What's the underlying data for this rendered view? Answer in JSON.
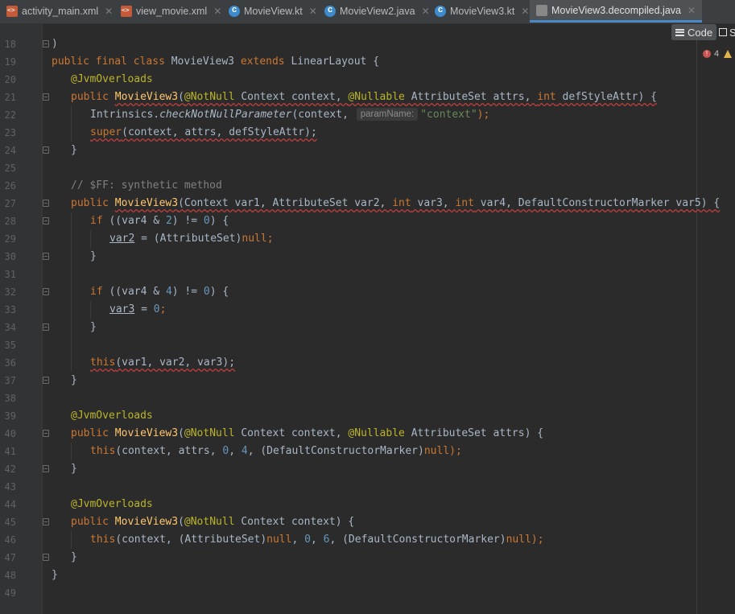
{
  "tabs": [
    {
      "label": "activity_main.xml",
      "icon": "xml-file-icon"
    },
    {
      "label": "view_movie.xml",
      "icon": "xml-file-icon"
    },
    {
      "label": "MovieView.kt",
      "icon": "kotlin-class-icon"
    },
    {
      "label": "MovieView2.java",
      "icon": "java-class-icon"
    },
    {
      "label": "MovieView3.kt",
      "icon": "kotlin-class-icon"
    },
    {
      "label": "MovieView3.decompiled.java",
      "icon": "decompiled-file-icon",
      "active": true
    }
  ],
  "toolbar": {
    "code_label": "Code",
    "split_label": "S"
  },
  "inspection": {
    "error_count": "4"
  },
  "line_numbers": [
    "18",
    "19",
    "20",
    "21",
    "22",
    "23",
    "24",
    "25",
    "26",
    "27",
    "28",
    "29",
    "30",
    "31",
    "32",
    "33",
    "34",
    "35",
    "36",
    "37",
    "38",
    "39",
    "40",
    "41",
    "42",
    "43",
    "44",
    "45",
    "46",
    "47",
    "48",
    "49"
  ],
  "code": {
    "l18": ")",
    "l19_public": "public",
    "l19_final": "final",
    "l19_class": "class",
    "l19_name": "MovieView3",
    "l19_extends": "extends",
    "l19_super": "LinearLayout {",
    "l20": "@JvmOverloads",
    "l21_public": "public",
    "l21_fn": "MovieView3",
    "l21_open": "(",
    "l21_ann1": "@NotNull",
    "l21_p1": " Context context, ",
    "l21_ann2": "@Nullable",
    "l21_p2": " AttributeSet attrs, ",
    "l21_int": "int",
    "l21_p3": " defStyleAttr) {",
    "l22_cls": "Intrinsics.",
    "l22_m": "checkNotNullParameter",
    "l22_a": "(context, ",
    "l22_hint": "paramName:",
    "l22_s": "\"context\"",
    "l22_end": ");",
    "l23_super": "super",
    "l23_rest": "(context, attrs, defStyleAttr);",
    "l24": "}",
    "l26": "// $FF: synthetic method",
    "l27_public": "public",
    "l27_fn": "MovieView3",
    "l27_a": "(Context var1, AttributeSet var2, ",
    "l27_int1": "int",
    "l27_b": " var3, ",
    "l27_int2": "int",
    "l27_c": " var4, DefaultConstructorMarker var5) {",
    "l28_if": "if",
    "l28_a": " ((var4 & ",
    "l28_n": "2",
    "l28_b": ") != ",
    "l28_z": "0",
    "l28_c": ") {",
    "l29_v": "var2",
    "l29_a": " = (AttributeSet)",
    "l29_null": "null",
    "l29_semi": ";",
    "l30": "}",
    "l32_if": "if",
    "l32_a": " ((var4 & ",
    "l32_n": "4",
    "l32_b": ") != ",
    "l32_z": "0",
    "l32_c": ") {",
    "l33_v": "var3",
    "l33_a": " = ",
    "l33_z": "0",
    "l33_semi": ";",
    "l34": "}",
    "l36_this": "this",
    "l36_rest": "(var1, var2, var3);",
    "l37": "}",
    "l39": "@JvmOverloads",
    "l40_public": "public",
    "l40_fn": "MovieView3",
    "l40_open": "(",
    "l40_ann1": "@NotNull",
    "l40_p1": " Context context, ",
    "l40_ann2": "@Nullable",
    "l40_p2": " AttributeSet attrs) {",
    "l41_this": "this",
    "l41_a": "(context, attrs, ",
    "l41_z": "0",
    "l41_b": ", ",
    "l41_n": "4",
    "l41_c": ", (DefaultConstructorMarker)",
    "l41_null": "null",
    "l41_end": ");",
    "l42": "}",
    "l44": "@JvmOverloads",
    "l45_public": "public",
    "l45_fn": "MovieView3",
    "l45_open": "(",
    "l45_ann": "@NotNull",
    "l45_p": " Context context) {",
    "l46_this": "this",
    "l46_a": "(context, (AttributeSet)",
    "l46_null1": "null",
    "l46_b": ", ",
    "l46_z": "0",
    "l46_c": ", ",
    "l46_n": "6",
    "l46_d": ", (DefaultConstructorMarker)",
    "l46_null2": "null",
    "l46_end": ");",
    "l47": "}",
    "l48": "}"
  }
}
